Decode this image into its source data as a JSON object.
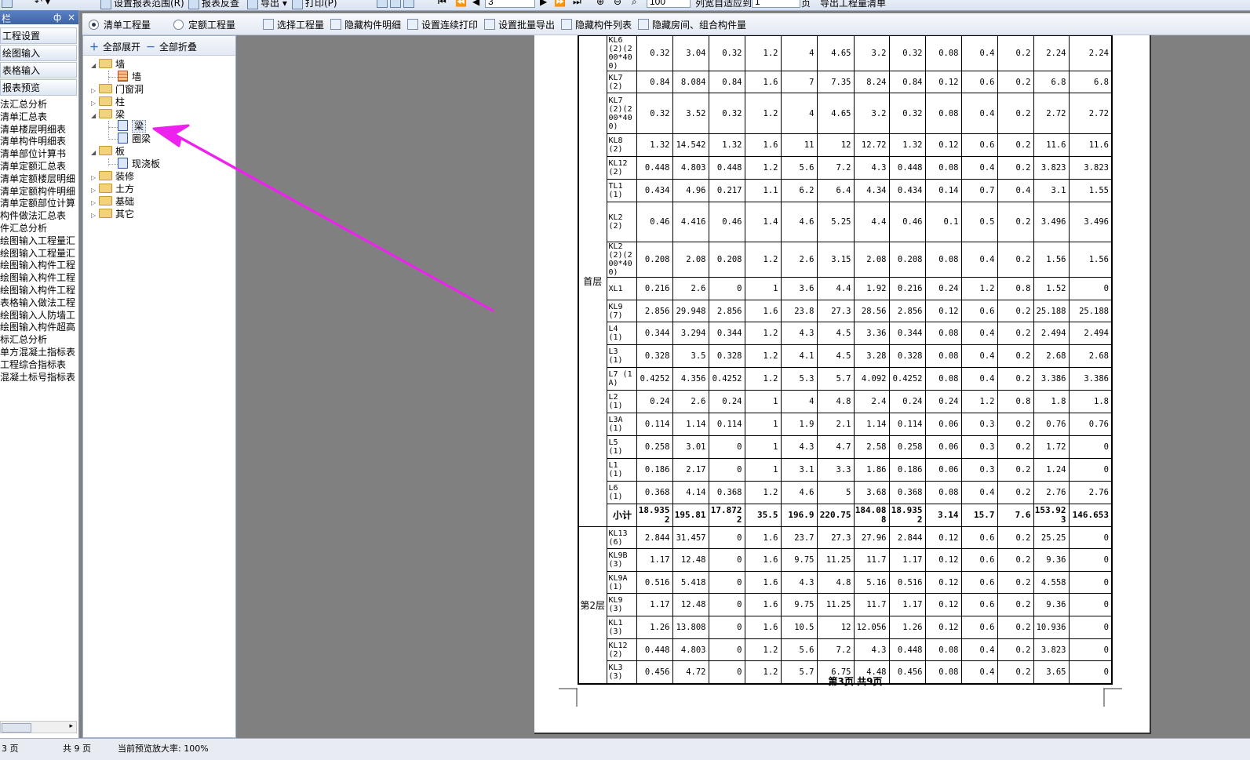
{
  "toolbar": {
    "set_range": "设置报表范围(R)",
    "report_query": "报表反查",
    "export": "导出",
    "print": "打印(P)",
    "page_input": "3",
    "zoom_input": "100",
    "col_width": "列宽自适应到",
    "col_width_value": "1",
    "page_unit": "页",
    "export_list": "导出工程量清单"
  },
  "nav": {
    "header": "栏",
    "pin": "ф",
    "close": "×",
    "buttons": [
      "工程设置",
      "绘图输入",
      "表格输入",
      "报表预览"
    ],
    "items": [
      "法汇总分析",
      "清单汇总表",
      "清单楼层明细表",
      "清单构件明细表",
      "清单部位计算书",
      "清单定额汇总表",
      "清单定额楼层明细",
      "清单定额构件明细",
      "清单定额部位计算",
      "构件做法汇总表",
      "件汇总分析",
      "绘图输入工程量汇",
      "绘图输入工程量汇",
      "绘图输入构件工程",
      "绘图输入构件工程",
      "绘图输入构件工程",
      "表格输入做法工程",
      "绘图输入人防墙工",
      "绘图输入构件超高",
      "标汇总分析",
      "单方混凝土指标表",
      "工程综合指标表",
      "混凝土标号指标表"
    ]
  },
  "options": {
    "radio1": "清单工程量",
    "radio2": "定额工程量",
    "select_qty": "选择工程量",
    "hide_detail": "隐藏构件明细",
    "cont_print": "设置连续打印",
    "batch_export": "设置批量导出",
    "hide_list": "隐藏构件列表",
    "hide_rooms": "隐藏房间、组合构件量"
  },
  "tree": {
    "expand_all": "全部展开",
    "collapse_all": "全部折叠",
    "nodes": {
      "wall": "墙",
      "wall_child": "墙",
      "door": "门窗洞",
      "column": "柱",
      "beam": "梁",
      "beam_child": "梁",
      "ring_beam": "圈梁",
      "slab": "板",
      "slab_child": "现浇板",
      "decor": "装修",
      "earth": "土方",
      "found": "基础",
      "other": "其它"
    }
  },
  "report": {
    "floor1": "首层",
    "floor2": "第2层",
    "rows1": [
      [
        "KL6 (2)(200*400)",
        "0.32",
        "3.04",
        "0.32",
        "1.2",
        "4",
        "4.65",
        "3.2",
        "0.32",
        "0.08",
        "0.4",
        "0.2",
        "2.24",
        "2.24"
      ],
      [
        "KL7 (2)",
        "0.84",
        "8.084",
        "0.84",
        "1.6",
        "7",
        "7.35",
        "8.24",
        "0.84",
        "0.12",
        "0.6",
        "0.2",
        "6.8",
        "6.8"
      ],
      [
        "KL7 (2)(200*400)",
        "0.32",
        "3.52",
        "0.32",
        "1.2",
        "4",
        "4.65",
        "3.2",
        "0.32",
        "0.08",
        "0.4",
        "0.2",
        "2.72",
        "2.72"
      ],
      [
        "KL8 (2)",
        "1.32",
        "14.542",
        "1.32",
        "1.6",
        "11",
        "12",
        "12.72",
        "1.32",
        "0.12",
        "0.6",
        "0.2",
        "11.6",
        "11.6"
      ],
      [
        "KL12 (2)",
        "0.448",
        "4.803",
        "0.448",
        "1.2",
        "5.6",
        "7.2",
        "4.3",
        "0.448",
        "0.08",
        "0.4",
        "0.2",
        "3.823",
        "3.823"
      ],
      [
        "TL1 (1)",
        "0.434",
        "4.96",
        "0.217",
        "1.1",
        "6.2",
        "6.4",
        "4.34",
        "0.434",
        "0.14",
        "0.7",
        "0.4",
        "3.1",
        "1.55"
      ],
      [
        "KL2 (2)",
        "0.46",
        "4.416",
        "0.46",
        "1.4",
        "4.6",
        "5.25",
        "4.4",
        "0.46",
        "0.1",
        "0.5",
        "0.2",
        "3.496",
        "3.496"
      ],
      [
        "KL2 (2)(200*400)",
        "0.208",
        "2.08",
        "0.208",
        "1.2",
        "2.6",
        "3.15",
        "2.08",
        "0.208",
        "0.08",
        "0.4",
        "0.2",
        "1.56",
        "1.56"
      ],
      [
        "XL1",
        "0.216",
        "2.6",
        "0",
        "1",
        "3.6",
        "4.4",
        "1.92",
        "0.216",
        "0.24",
        "1.2",
        "0.8",
        "1.52",
        "0"
      ],
      [
        "KL9 (7)",
        "2.856",
        "29.948",
        "2.856",
        "1.6",
        "23.8",
        "27.3",
        "28.56",
        "2.856",
        "0.12",
        "0.6",
        "0.2",
        "25.188",
        "25.188"
      ],
      [
        "L4 (1)",
        "0.344",
        "3.294",
        "0.344",
        "1.2",
        "4.3",
        "4.5",
        "3.36",
        "0.344",
        "0.08",
        "0.4",
        "0.2",
        "2.494",
        "2.494"
      ],
      [
        "L3 (1)",
        "0.328",
        "3.5",
        "0.328",
        "1.2",
        "4.1",
        "4.5",
        "3.28",
        "0.328",
        "0.08",
        "0.4",
        "0.2",
        "2.68",
        "2.68"
      ],
      [
        "L7 (1A)",
        "0.4252",
        "4.356",
        "0.4252",
        "1.2",
        "5.3",
        "5.7",
        "4.092",
        "0.4252",
        "0.08",
        "0.4",
        "0.2",
        "3.386",
        "3.386"
      ],
      [
        "L2 (1)",
        "0.24",
        "2.6",
        "0.24",
        "1",
        "4",
        "4.8",
        "2.4",
        "0.24",
        "0.24",
        "1.2",
        "0.8",
        "1.8",
        "1.8"
      ],
      [
        "L3A (1)",
        "0.114",
        "1.14",
        "0.114",
        "1",
        "1.9",
        "2.1",
        "1.14",
        "0.114",
        "0.06",
        "0.3",
        "0.2",
        "0.76",
        "0.76"
      ],
      [
        "L5 (1)",
        "0.258",
        "3.01",
        "0",
        "1",
        "4.3",
        "4.7",
        "2.58",
        "0.258",
        "0.06",
        "0.3",
        "0.2",
        "1.72",
        "0"
      ],
      [
        "L1 (1)",
        "0.186",
        "2.17",
        "0",
        "1",
        "3.1",
        "3.3",
        "1.86",
        "0.186",
        "0.06",
        "0.3",
        "0.2",
        "1.24",
        "0"
      ],
      [
        "L6 (1)",
        "0.368",
        "4.14",
        "0.368",
        "1.2",
        "4.6",
        "5",
        "3.68",
        "0.368",
        "0.08",
        "0.4",
        "0.2",
        "2.76",
        "2.76"
      ]
    ],
    "subtotal": [
      "小计",
      "18.9352",
      "195.81",
      "17.8722",
      "35.5",
      "196.9",
      "220.75",
      "184.088",
      "18.9352",
      "3.14",
      "15.7",
      "7.6",
      "153.923",
      "146.653"
    ],
    "rows2": [
      [
        "KL13 (6)",
        "2.844",
        "31.457",
        "0",
        "1.6",
        "23.7",
        "27.3",
        "27.96",
        "2.844",
        "0.12",
        "0.6",
        "0.2",
        "25.25",
        "0"
      ],
      [
        "KL9B (3)",
        "1.17",
        "12.48",
        "0",
        "1.6",
        "9.75",
        "11.25",
        "11.7",
        "1.17",
        "0.12",
        "0.6",
        "0.2",
        "9.36",
        "0"
      ],
      [
        "KL9A (1)",
        "0.516",
        "5.418",
        "0",
        "1.6",
        "4.3",
        "4.8",
        "5.16",
        "0.516",
        "0.12",
        "0.6",
        "0.2",
        "4.558",
        "0"
      ],
      [
        "KL9 (3)",
        "1.17",
        "12.48",
        "0",
        "1.6",
        "9.75",
        "11.25",
        "11.7",
        "1.17",
        "0.12",
        "0.6",
        "0.2",
        "9.36",
        "0"
      ],
      [
        "KL1 (3)",
        "1.26",
        "13.808",
        "0",
        "1.6",
        "10.5",
        "12",
        "12.056",
        "1.26",
        "0.12",
        "0.6",
        "0.2",
        "10.936",
        "0"
      ],
      [
        "KL12 (2)",
        "0.448",
        "4.803",
        "0",
        "1.2",
        "5.6",
        "7.2",
        "4.3",
        "0.448",
        "0.08",
        "0.4",
        "0.2",
        "3.823",
        "0"
      ],
      [
        "KL3 (3)",
        "0.456",
        "4.72",
        "0",
        "1.2",
        "5.7",
        "6.75",
        "4.48",
        "0.456",
        "0.08",
        "0.4",
        "0.2",
        "3.65",
        "0"
      ]
    ],
    "page_label": "第3页 共9页"
  },
  "status": {
    "page": "3 页",
    "total": "共 9 页",
    "zoom": "当前预览放大率: 100%"
  },
  "colors": {
    "annotation_arrow": "#ee22ee"
  }
}
